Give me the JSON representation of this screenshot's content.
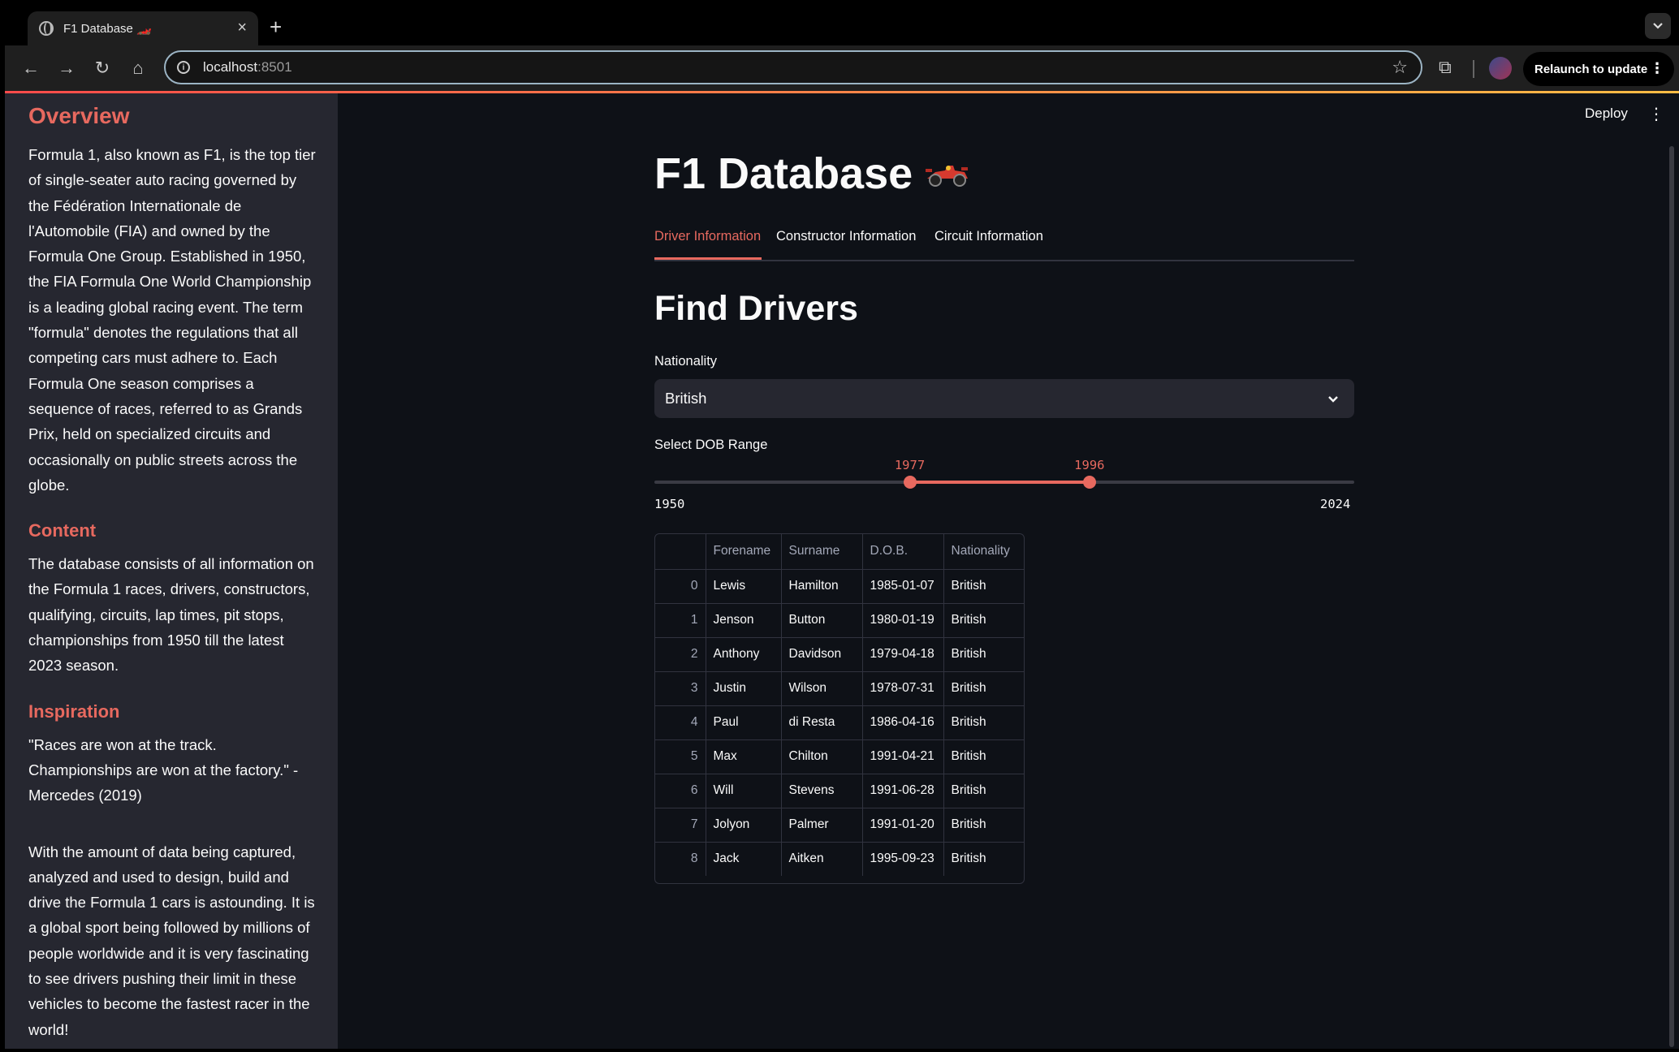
{
  "browser": {
    "tab_title": "F1 Database 🏎️",
    "url_host": "localhost",
    "url_port": ":8501",
    "relaunch_label": "Relaunch to update",
    "icons": [
      "globe-icon",
      "close-icon",
      "plus-icon",
      "chevron-down-icon",
      "back-icon",
      "forward-icon",
      "reload-icon",
      "home-icon",
      "info-icon",
      "star-icon",
      "extensions-icon",
      "avatar",
      "kebab-icon"
    ]
  },
  "sidebar": {
    "overview_heading": "Overview",
    "overview_text": "Formula 1, also known as F1, is the top tier of single-seater auto racing governed by the Fédération Internationale de l'Automobile (FIA) and owned by the Formula One Group. Established in 1950, the FIA Formula One World Championship is a leading global racing event. The term \"formula\" denotes the regulations that all competing cars must adhere to. Each Formula One season comprises a sequence of races, referred to as Grands Prix, held on specialized circuits and occasionally on public streets across the globe.",
    "content_heading": "Content",
    "content_text": "The database consists of all information on the Formula 1 races, drivers, constructors, qualifying, circuits, lap times, pit stops, championships from 1950 till the latest 2023 season.",
    "inspiration_heading": "Inspiration",
    "inspiration_quote": "\"Races are won at the track. Championships are won at the factory.\" - Mercedes (2019)",
    "inspiration_text": "With the amount of data being captured, analyzed and used to design, build and drive the Formula 1 cars is astounding. It is a global sport being followed by millions of people worldwide and it is very fascinating to see drivers pushing their limit in these vehicles to become the fastest racer in the world!"
  },
  "header": {
    "deploy_label": "Deploy"
  },
  "main": {
    "title": "F1 Database",
    "tabs": [
      {
        "label": "Driver Information",
        "active": true
      },
      {
        "label": "Constructor Information",
        "active": false
      },
      {
        "label": "Circuit Information",
        "active": false
      }
    ],
    "section_title": "Find Drivers",
    "nationality_label": "Nationality",
    "nationality_value": "British",
    "dob_label": "Select DOB Range",
    "slider": {
      "min": 1950,
      "max": 2024,
      "low": 1977,
      "high": 1996
    },
    "table": {
      "columns": [
        "",
        "Forename",
        "Surname",
        "D.O.B.",
        "Nationality"
      ],
      "rows": [
        [
          "0",
          "Lewis",
          "Hamilton",
          "1985-01-07",
          "British"
        ],
        [
          "1",
          "Jenson",
          "Button",
          "1980-01-19",
          "British"
        ],
        [
          "2",
          "Anthony",
          "Davidson",
          "1979-04-18",
          "British"
        ],
        [
          "3",
          "Justin",
          "Wilson",
          "1978-07-31",
          "British"
        ],
        [
          "4",
          "Paul",
          "di Resta",
          "1986-04-16",
          "British"
        ],
        [
          "5",
          "Max",
          "Chilton",
          "1991-04-21",
          "British"
        ],
        [
          "6",
          "Will",
          "Stevens",
          "1991-06-28",
          "British"
        ],
        [
          "7",
          "Jolyon",
          "Palmer",
          "1991-01-20",
          "British"
        ],
        [
          "8",
          "Jack",
          "Aitken",
          "1995-09-23",
          "British"
        ]
      ]
    }
  },
  "colors": {
    "accent": "#e7695f",
    "background": "#0e1117",
    "sidebar": "#262730"
  }
}
